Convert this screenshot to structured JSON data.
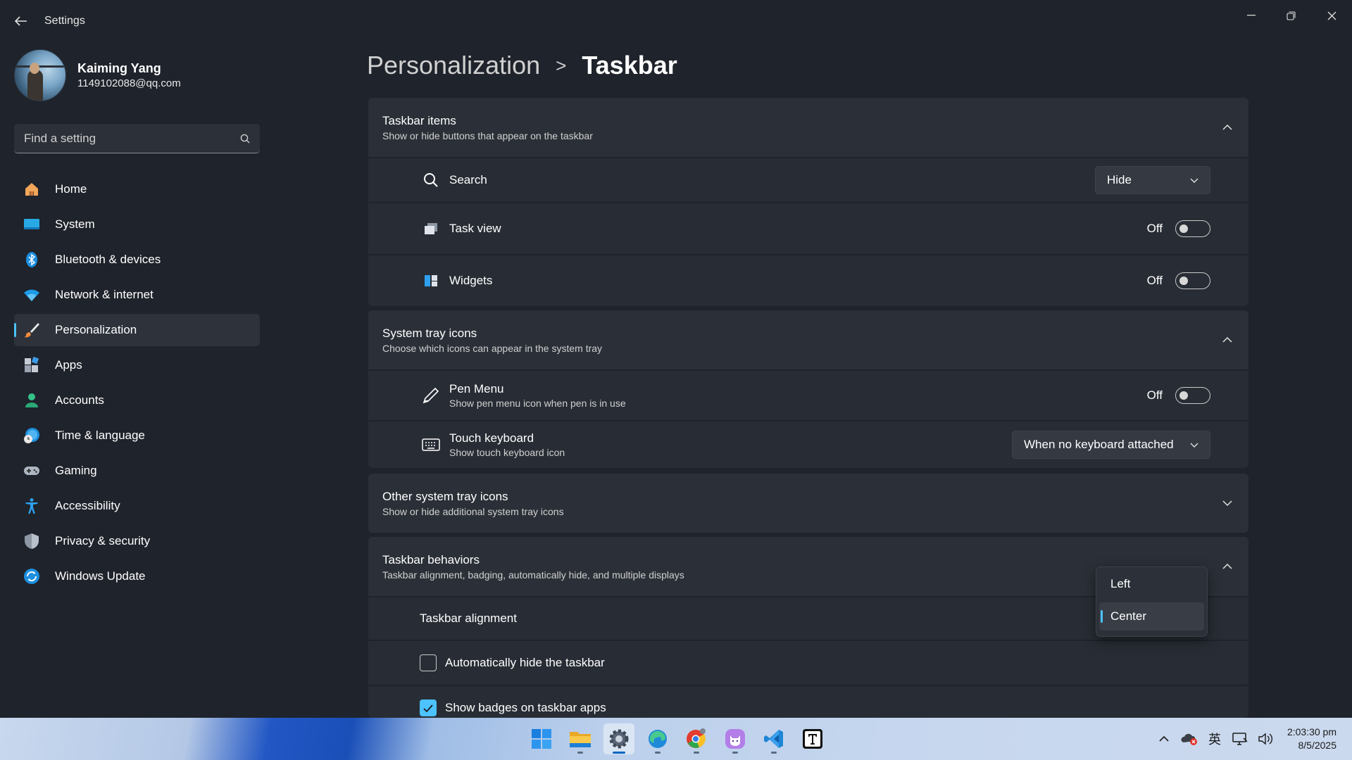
{
  "window": {
    "title": "Settings"
  },
  "profile": {
    "name": "Kaiming Yang",
    "email": "1149102088@qq.com"
  },
  "search": {
    "placeholder": "Find a setting"
  },
  "sidebar": {
    "items": [
      {
        "label": "Home",
        "icon": "home-icon"
      },
      {
        "label": "System",
        "icon": "system-icon"
      },
      {
        "label": "Bluetooth & devices",
        "icon": "bluetooth-icon"
      },
      {
        "label": "Network & internet",
        "icon": "wifi-icon"
      },
      {
        "label": "Personalization",
        "icon": "brush-icon",
        "active": true
      },
      {
        "label": "Apps",
        "icon": "apps-icon"
      },
      {
        "label": "Accounts",
        "icon": "accounts-icon"
      },
      {
        "label": "Time & language",
        "icon": "clock-globe-icon"
      },
      {
        "label": "Gaming",
        "icon": "gamepad-icon"
      },
      {
        "label": "Accessibility",
        "icon": "accessibility-icon"
      },
      {
        "label": "Privacy & security",
        "icon": "shield-icon"
      },
      {
        "label": "Windows Update",
        "icon": "update-icon"
      }
    ]
  },
  "breadcrumb": {
    "parent": "Personalization",
    "separator": ">",
    "current": "Taskbar"
  },
  "taskbar_items": {
    "title": "Taskbar items",
    "subtitle": "Show or hide buttons that appear on the taskbar",
    "search": {
      "label": "Search",
      "value": "Hide"
    },
    "task_view": {
      "label": "Task view",
      "state": "Off"
    },
    "widgets": {
      "label": "Widgets",
      "state": "Off"
    }
  },
  "system_tray": {
    "title": "System tray icons",
    "subtitle": "Choose which icons can appear in the system tray",
    "pen_menu": {
      "label": "Pen Menu",
      "sub": "Show pen menu icon when pen is in use",
      "state": "Off"
    },
    "touch_keyboard": {
      "label": "Touch keyboard",
      "sub": "Show touch keyboard icon",
      "value": "When no keyboard attached"
    }
  },
  "other_tray": {
    "title": "Other system tray icons",
    "subtitle": "Show or hide additional system tray icons"
  },
  "behaviors": {
    "title": "Taskbar behaviors",
    "subtitle": "Taskbar alignment, badging, automatically hide, and multiple displays",
    "alignment": {
      "label": "Taskbar alignment",
      "options": [
        "Left",
        "Center"
      ],
      "selected": "Center"
    },
    "auto_hide": {
      "label": "Automatically hide the taskbar",
      "checked": false
    },
    "badges": {
      "label": "Show badges on taskbar apps",
      "checked": true
    }
  },
  "system_taskbar": {
    "apps": [
      "start-icon",
      "file-explorer-icon",
      "settings-icon",
      "edge-icon",
      "chrome-icon",
      "cat-app-icon",
      "vscode-icon",
      "typora-icon"
    ],
    "ime": "英",
    "time": "2:03:30 pm",
    "date": "8/5/2025"
  },
  "colors": {
    "accent": "#4cc2ff",
    "background": "#1f232b",
    "panel": "#282d35"
  }
}
